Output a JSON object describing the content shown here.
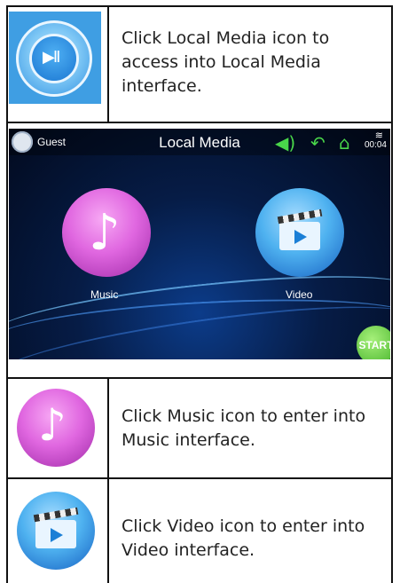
{
  "rows": [
    {
      "text": "Click Local Media icon to access into Local Media interface.",
      "icon": "play-pause-icon"
    },
    {
      "screen": {
        "user": "Guest",
        "title": "Local Media",
        "time": "00:04",
        "music_label": "Music",
        "video_label": "Video",
        "start_label": "START",
        "icons": [
          "avatar-icon",
          "volume-icon",
          "back-icon",
          "home-icon",
          "wifi-icon"
        ]
      }
    },
    {
      "text": "Click Music icon to enter into Music interface.",
      "icon": "music-note-icon"
    },
    {
      "text": "Click Video icon to enter into Video interface.",
      "icon": "video-clapper-icon"
    }
  ],
  "colors": {
    "border": "#111111",
    "music": "#e067e0",
    "video": "#4fb2f0",
    "status_green": "#49d64a"
  }
}
